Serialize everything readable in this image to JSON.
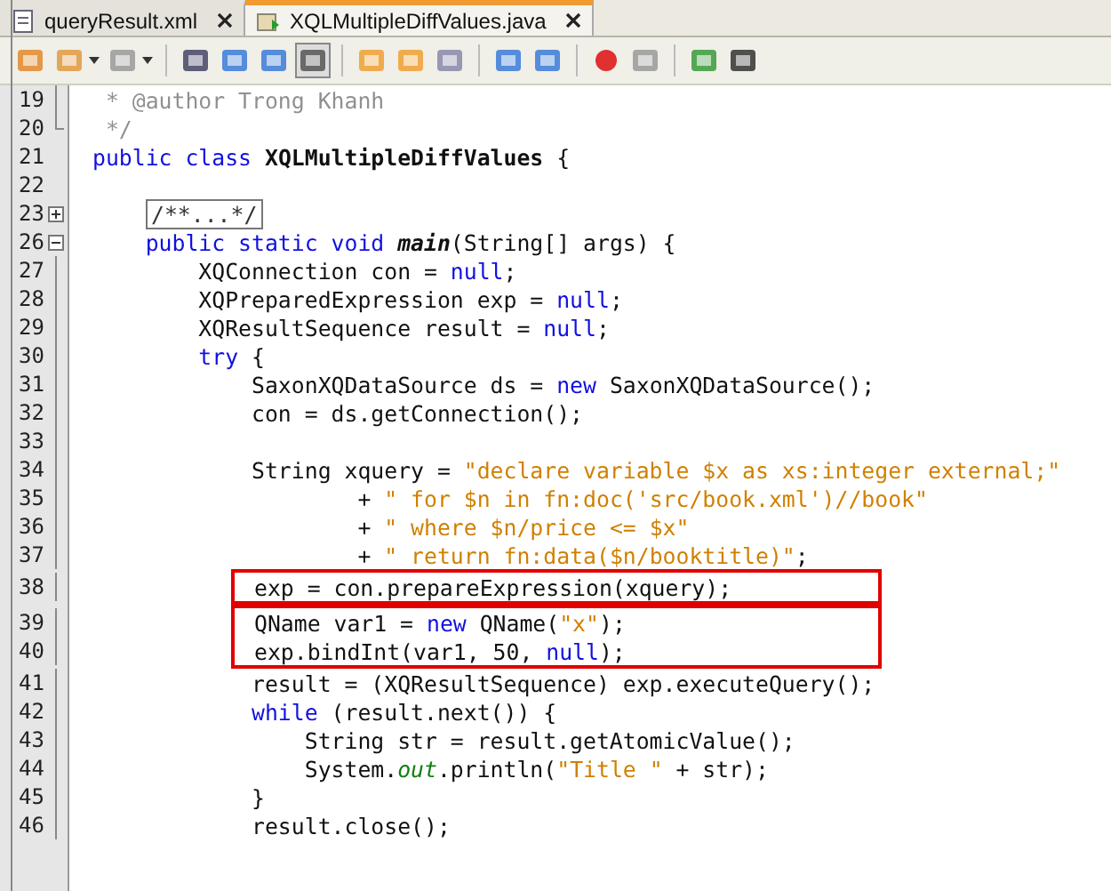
{
  "tabs": [
    {
      "label": "queryResult.xml",
      "selected": false
    },
    {
      "label": "XQLMultipleDiffValues.java",
      "selected": true
    }
  ],
  "editor": {
    "lines": [
      {
        "kind": "line",
        "number": "19",
        "gutter": {
          "kind": "guide"
        },
        "tokens": [
          {
            "kind": "comment",
            "t": " * @author Trong Khanh"
          }
        ]
      },
      {
        "kind": "line",
        "number": "20",
        "gutter": {
          "kind": "guide-end"
        },
        "tokens": [
          {
            "kind": "comment",
            "t": " */"
          }
        ]
      },
      {
        "kind": "line",
        "number": "21",
        "tokens": [
          {
            "kind": "keyword",
            "t": "public class "
          },
          {
            "kind": "bold",
            "t": "XQLMultipleDiffValues"
          },
          {
            "kind": "plain",
            "t": " {"
          }
        ]
      },
      {
        "kind": "line",
        "number": "22"
      },
      {
        "kind": "line",
        "number": "23",
        "gutter": {
          "kind": "expand"
        },
        "tokens": [
          {
            "kind": "folded",
            "t": "/**...*/"
          }
        ]
      },
      {
        "kind": "line",
        "number": "26",
        "gutter": {
          "kind": "collapse"
        },
        "tokens": [
          {
            "kind": "keyword",
            "t": "    public static void "
          },
          {
            "kind": "method",
            "t": "main"
          },
          {
            "kind": "plain",
            "t": "(String[] args) {"
          }
        ]
      },
      {
        "kind": "line",
        "number": "27",
        "gutter": {
          "kind": "guide"
        },
        "tokens": [
          {
            "kind": "plain",
            "t": "        XQConnection con = "
          },
          {
            "kind": "keyword",
            "t": "null"
          },
          {
            "kind": "plain",
            "t": ";"
          }
        ]
      },
      {
        "kind": "line",
        "number": "28",
        "gutter": {
          "kind": "guide"
        },
        "tokens": [
          {
            "kind": "plain",
            "t": "        XQPreparedExpression exp = "
          },
          {
            "kind": "keyword",
            "t": "null"
          },
          {
            "kind": "plain",
            "t": ";"
          }
        ]
      },
      {
        "kind": "line",
        "number": "29",
        "gutter": {
          "kind": "guide"
        },
        "tokens": [
          {
            "kind": "plain",
            "t": "        XQResultSequence result = "
          },
          {
            "kind": "keyword",
            "t": "null"
          },
          {
            "kind": "plain",
            "t": ";"
          }
        ]
      },
      {
        "kind": "line",
        "number": "30",
        "gutter": {
          "kind": "guide"
        },
        "tokens": [
          {
            "kind": "keyword",
            "t": "        try"
          },
          {
            "kind": "plain",
            "t": " {"
          }
        ]
      },
      {
        "kind": "line",
        "number": "31",
        "gutter": {
          "kind": "guide"
        },
        "tokens": [
          {
            "kind": "plain",
            "t": "            SaxonXQDataSource ds = "
          },
          {
            "kind": "keyword",
            "t": "new"
          },
          {
            "kind": "plain",
            "t": " SaxonXQDataSource();"
          }
        ]
      },
      {
        "kind": "line",
        "number": "32",
        "gutter": {
          "kind": "guide"
        },
        "tokens": [
          {
            "kind": "plain",
            "t": "            con = ds.getConnection();"
          }
        ]
      },
      {
        "kind": "line",
        "number": "33",
        "gutter": {
          "kind": "guide"
        }
      },
      {
        "kind": "line",
        "number": "34",
        "gutter": {
          "kind": "guide"
        },
        "tokens": [
          {
            "kind": "plain",
            "t": "            String xquery = "
          },
          {
            "kind": "string",
            "t": "\"declare variable $x as xs:integer external;\""
          }
        ]
      },
      {
        "kind": "line",
        "number": "35",
        "gutter": {
          "kind": "guide"
        },
        "tokens": [
          {
            "kind": "plain",
            "t": "                    + "
          },
          {
            "kind": "string",
            "t": "\" for $n in fn:doc('src/book.xml')//book\""
          }
        ]
      },
      {
        "kind": "line",
        "number": "36",
        "gutter": {
          "kind": "guide"
        },
        "tokens": [
          {
            "kind": "plain",
            "t": "                    + "
          },
          {
            "kind": "string",
            "t": "\" where $n/price <= $x\""
          }
        ]
      },
      {
        "kind": "line",
        "number": "37",
        "gutter": {
          "kind": "guide"
        },
        "tokens": [
          {
            "kind": "plain",
            "t": "                    + "
          },
          {
            "kind": "string",
            "t": "\" return fn:data($n/booktitle)\""
          },
          {
            "kind": "plain",
            "t": ";"
          }
        ]
      },
      {
        "kind": "box",
        "lines": [
          {
            "number": "38",
            "gutter": {
              "kind": "guide"
            },
            "tokens": [
              {
                "kind": "plain",
                "t": "exp = con.prepareExpression(xquery);"
              }
            ]
          }
        ]
      },
      {
        "kind": "box",
        "lines": [
          {
            "number": "39",
            "gutter": {
              "kind": "guide"
            },
            "tokens": [
              {
                "kind": "plain",
                "t": "QName var1 = "
              },
              {
                "kind": "keyword",
                "t": "new"
              },
              {
                "kind": "plain",
                "t": " QName("
              },
              {
                "kind": "string",
                "t": "\"x\""
              },
              {
                "kind": "plain",
                "t": ");"
              }
            ]
          },
          {
            "number": "40",
            "gutter": {
              "kind": "guide"
            },
            "tokens": [
              {
                "kind": "plain",
                "t": "exp.bindInt(var1, 50, "
              },
              {
                "kind": "keyword",
                "t": "null"
              },
              {
                "kind": "plain",
                "t": ");"
              }
            ]
          }
        ]
      },
      {
        "kind": "line",
        "number": "41",
        "gutter": {
          "kind": "guide"
        },
        "tokens": [
          {
            "kind": "plain",
            "t": "            result = (XQResultSequence) exp.executeQuery();"
          }
        ]
      },
      {
        "kind": "line",
        "number": "42",
        "gutter": {
          "kind": "guide"
        },
        "tokens": [
          {
            "kind": "keyword",
            "t": "            while"
          },
          {
            "kind": "plain",
            "t": " (result.next()) {"
          }
        ]
      },
      {
        "kind": "line",
        "number": "43",
        "gutter": {
          "kind": "guide"
        },
        "tokens": [
          {
            "kind": "plain",
            "t": "                String str = result.getAtomicValue();"
          }
        ]
      },
      {
        "kind": "line",
        "number": "44",
        "gutter": {
          "kind": "guide"
        },
        "tokens": [
          {
            "kind": "plain",
            "t": "                System."
          },
          {
            "kind": "field",
            "t": "out"
          },
          {
            "kind": "plain",
            "t": ".println("
          },
          {
            "kind": "string",
            "t": "\"Title \""
          },
          {
            "kind": "plain",
            "t": " + str);"
          }
        ]
      },
      {
        "kind": "line",
        "number": "45",
        "gutter": {
          "kind": "guide"
        },
        "tokens": [
          {
            "kind": "plain",
            "t": "            }"
          }
        ]
      },
      {
        "kind": "line",
        "number": "46",
        "gutter": {
          "kind": "guide"
        },
        "tokens": [
          {
            "kind": "plain",
            "t": "            result.close();"
          }
        ]
      }
    ]
  }
}
